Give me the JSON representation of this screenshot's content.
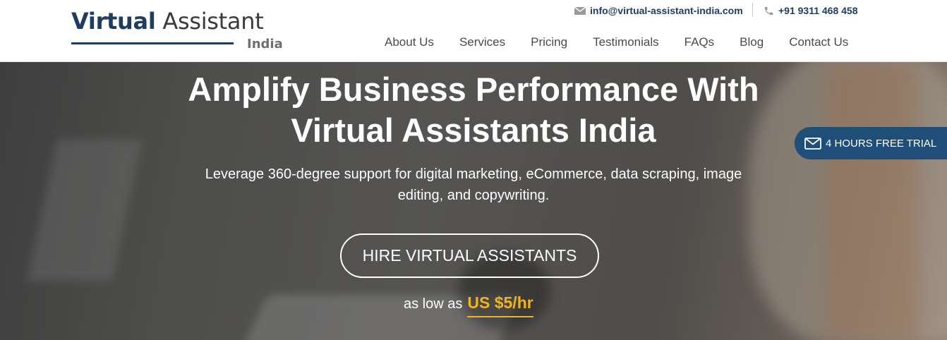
{
  "logo": {
    "word1": "Virtual",
    "word2": "Assistant",
    "sub": "India"
  },
  "contact": {
    "email_icon": "envelope-icon",
    "email": "info@virtual-assistant-india.com",
    "phone_icon": "phone-icon",
    "phone": "+91 9311 468 458"
  },
  "nav": {
    "items": [
      {
        "label": "About Us"
      },
      {
        "label": "Services"
      },
      {
        "label": "Pricing"
      },
      {
        "label": "Testimonials"
      },
      {
        "label": "FAQs"
      },
      {
        "label": "Blog"
      },
      {
        "label": "Contact Us"
      }
    ]
  },
  "hero": {
    "title_line1": "Amplify Business Performance With",
    "title_line2": "Virtual Assistants India",
    "subtitle_line1": "Leverage 360-degree support for digital marketing, eCommerce, data scraping, image",
    "subtitle_line2": "editing, and copywriting.",
    "cta_label": "HIRE VIRTUAL ASSISTANTS",
    "price_prefix": "as low as",
    "price_amount": "US $5/hr"
  },
  "trial_tab": {
    "icon": "envelope-icon",
    "label": "4 HOURS FREE TRIAL"
  },
  "colors": {
    "brand": "#1f3d62",
    "accent": "#f0b323",
    "trial_bg": "#1f4e79"
  }
}
